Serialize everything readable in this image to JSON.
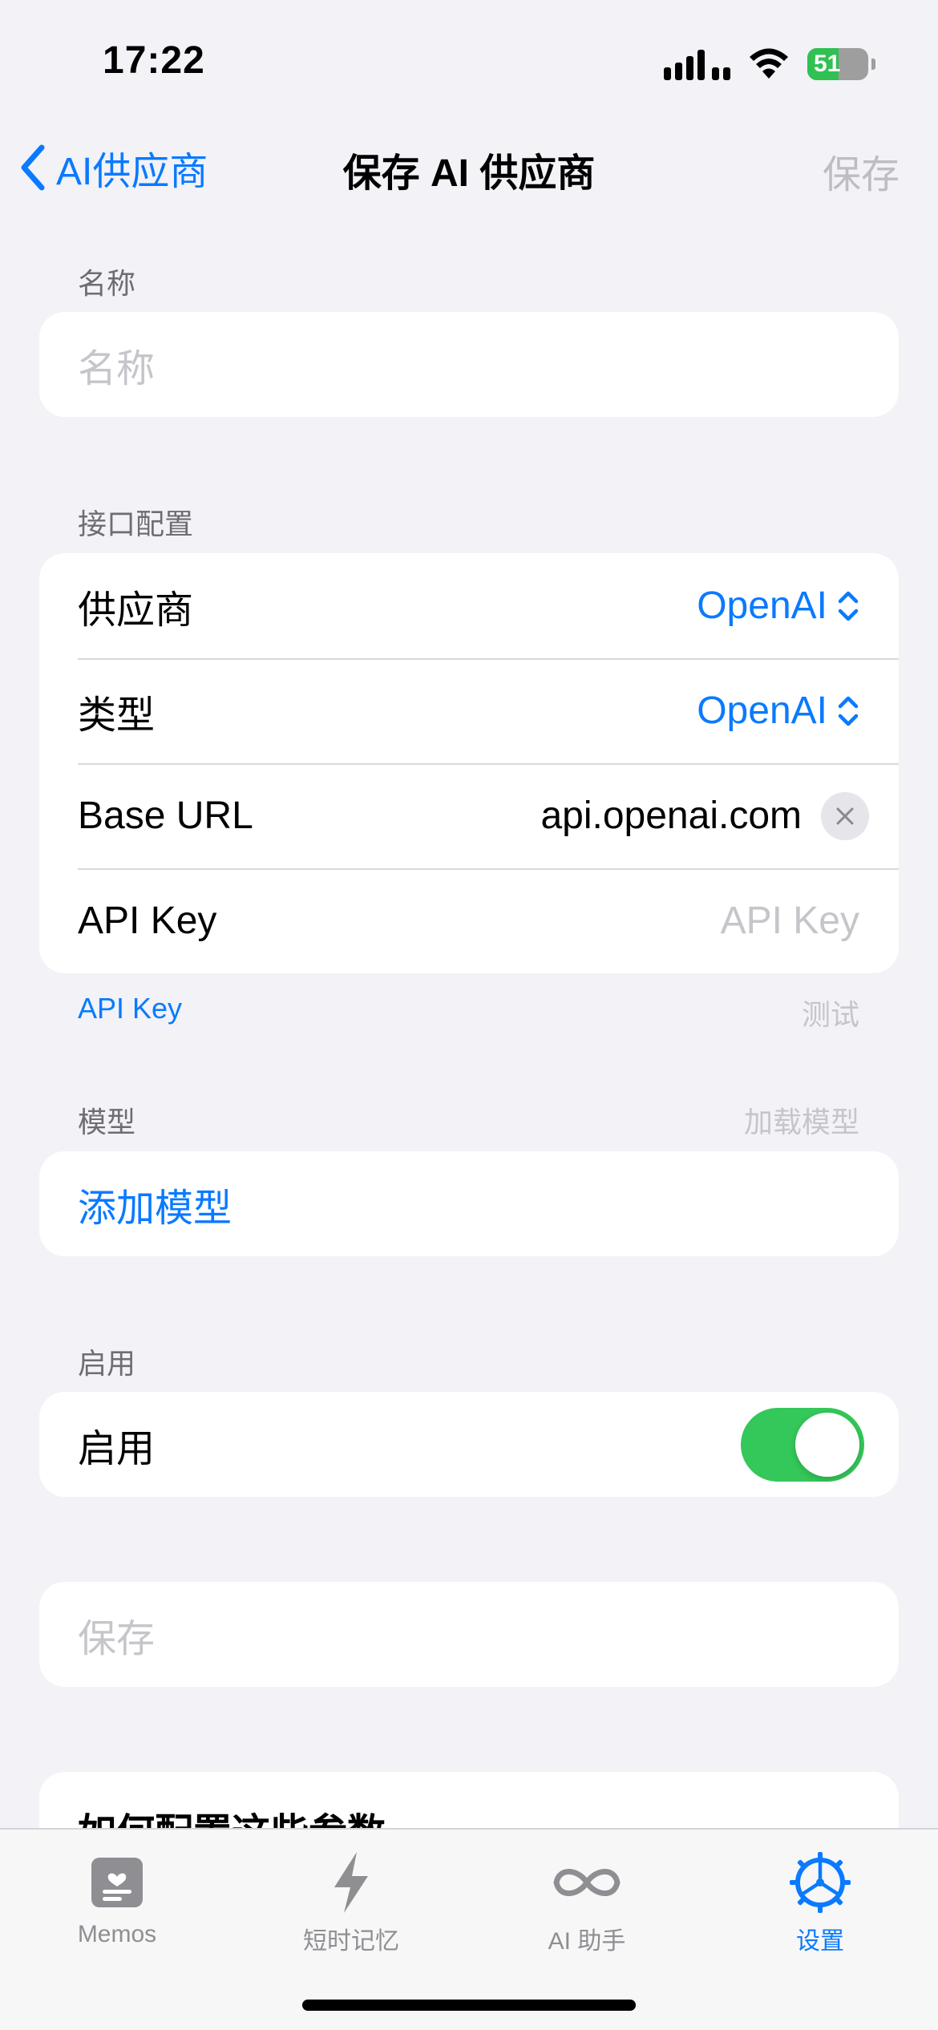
{
  "status_bar": {
    "time": "17:22",
    "battery": "51"
  },
  "nav": {
    "back_label": "AI供应商",
    "title": "保存 AI 供应商",
    "save_label": "保存"
  },
  "name_section": {
    "header": "名称",
    "placeholder": "名称"
  },
  "api_section": {
    "header": "接口配置",
    "provider": {
      "label": "供应商",
      "value": "OpenAI"
    },
    "type": {
      "label": "类型",
      "value": "OpenAI"
    },
    "base_url": {
      "label": "Base URL",
      "value": "api.openai.com"
    },
    "api_key": {
      "label": "API Key",
      "placeholder": "API Key"
    },
    "footer_link": "API Key",
    "footer_test": "测试"
  },
  "models_section": {
    "header": "模型",
    "load_label": "加载模型",
    "add_label": "添加模型"
  },
  "enable_section": {
    "header": "启用",
    "label": "启用",
    "enabled": true
  },
  "save_button": {
    "label": "保存"
  },
  "help_row": {
    "label": "如何配置这些参数"
  },
  "tabs": [
    {
      "label": "Memos",
      "icon": "memos-icon",
      "active": false
    },
    {
      "label": "短时记忆",
      "icon": "bolt-icon",
      "active": false
    },
    {
      "label": "AI 助手",
      "icon": "infinity-icon",
      "active": false
    },
    {
      "label": "设置",
      "icon": "settings-wheel-icon",
      "active": true
    }
  ],
  "colors": {
    "accent": "#0A7AFF",
    "toggle_on": "#34C759",
    "background": "#F2F2F7"
  }
}
